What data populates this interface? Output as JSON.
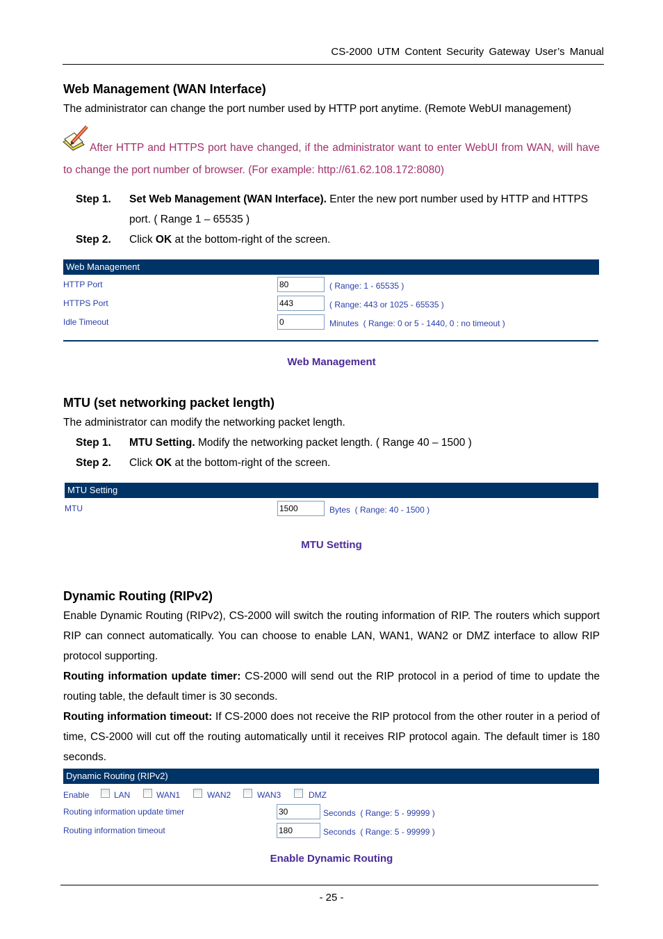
{
  "header": {
    "title": "CS-2000  UTM  Content  Security  Gateway  User’s  Manual"
  },
  "section_web": {
    "heading": "Web Management (WAN Interface)",
    "intro": "The administrator can change the port number used by HTTP port anytime. (Remote WebUI management)",
    "note_icon": "note-pencil-icon",
    "note": "After HTTP and HTTPS port have changed, if the administrator want to enter WebUI from WAN, will have to change the port number of browser. (For example: http://61.62.108.172:8080)",
    "steps": [
      {
        "label": "Step 1.",
        "bold": "Set Web Management (WAN Interface).",
        "text": " Enter the new port number used by HTTP and HTTPS port. ( Range 1 – 65535 )"
      },
      {
        "label": "Step 2.",
        "pre": "Click ",
        "bold": "OK",
        "text": " at the bottom-right of the screen."
      }
    ],
    "panel": {
      "title": "Web Management",
      "rows": [
        {
          "label": "HTTP Port",
          "value": "80",
          "hint": "( Range: 1 - 65535 )"
        },
        {
          "label": "HTTPS Port",
          "value": "443",
          "hint": "( Range: 443 or 1025 - 65535 )"
        },
        {
          "label": "Idle Timeout",
          "value": "0",
          "hint": "Minutes  ( Range: 0 or 5 - 1440, 0 : no timeout )"
        }
      ]
    },
    "caption": "Web Management"
  },
  "section_mtu": {
    "heading": "MTU (set networking packet length)",
    "intro": "The administrator can modify the networking packet length.",
    "steps": [
      {
        "label": "Step 1.",
        "bold": "MTU Setting.",
        "text": " Modify the networking packet length. ( Range 40 – 1500 )"
      },
      {
        "label": "Step 2.",
        "pre": "Click ",
        "bold": "OK",
        "text": " at the bottom-right of the screen."
      }
    ],
    "panel": {
      "title": "MTU Setting",
      "rows": [
        {
          "label": "MTU",
          "value": "1500",
          "hint": "Bytes  ( Range: 40 - 1500 )"
        }
      ]
    },
    "caption": "MTU Setting"
  },
  "section_rip": {
    "heading": "Dynamic Routing (RIPv2)",
    "intro": "Enable Dynamic Routing (RIPv2), CS-2000 will switch the routing information of RIP. The routers which support RIP can connect automatically. You can choose to enable LAN, WAN1, WAN2 or DMZ interface to allow RIP protocol supporting.",
    "timer_bold": "Routing information update timer:",
    "timer_text": " CS-2000 will send out the RIP protocol in a period of time to update the routing table, the default timer is 30 seconds.",
    "timeout_bold": "Routing information timeout:",
    "timeout_text": " If CS-2000 does not receive the RIP protocol from the other router in a period of time, CS-2000 will cut off the routing automatically until it receives RIP protocol again. The default timer is 180 seconds.",
    "panel": {
      "title": "Dynamic Routing (RIPv2)",
      "enable_label": "Enable",
      "interfaces": [
        {
          "name": "LAN",
          "checked": false
        },
        {
          "name": "WAN1",
          "checked": false
        },
        {
          "name": "WAN2",
          "checked": false
        },
        {
          "name": "WAN3",
          "checked": false
        },
        {
          "name": "DMZ",
          "checked": false
        }
      ],
      "rows": [
        {
          "label": "Routing information update timer",
          "value": "30",
          "hint": "Seconds  ( Range: 5 - 99999 )"
        },
        {
          "label": "Routing information timeout",
          "value": "180",
          "hint": "Seconds  ( Range: 5 - 99999 )"
        }
      ]
    },
    "caption": "Enable Dynamic Routing"
  },
  "footer": {
    "page": "- 25 -"
  }
}
